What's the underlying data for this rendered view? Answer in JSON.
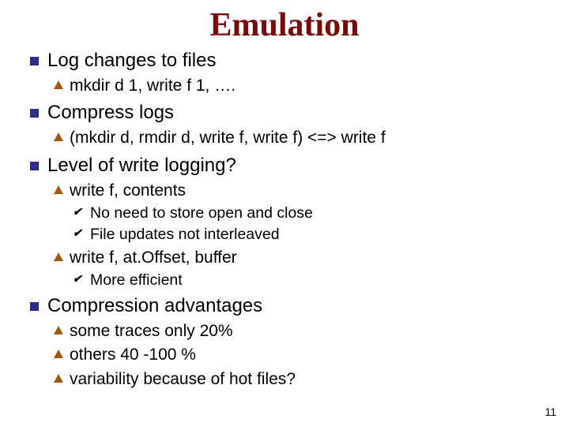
{
  "title": "Emulation",
  "page_number": "11",
  "bullets": {
    "b1": {
      "text": "Log changes to files",
      "sub": {
        "s1": "mkdir d 1, write f 1, …."
      }
    },
    "b2": {
      "text": "Compress logs",
      "sub": {
        "s1": "(mkdir d, rmdir d, write f, write f) <=> write f"
      }
    },
    "b3": {
      "text": "Level of write logging?",
      "sub": {
        "s1": {
          "text": "write f, contents",
          "sub": {
            "t1": "No need to store open and close",
            "t2": "File updates not interleaved"
          }
        },
        "s2": {
          "text": "write f, at.Offset, buffer",
          "sub": {
            "t1": "More efficient"
          }
        }
      }
    },
    "b4": {
      "text": "Compression advantages",
      "sub": {
        "s1": "some traces only 20%",
        "s2": "others 40 -100 %",
        "s3": "variability because of hot files?"
      }
    }
  },
  "level3_glyph": "✔"
}
